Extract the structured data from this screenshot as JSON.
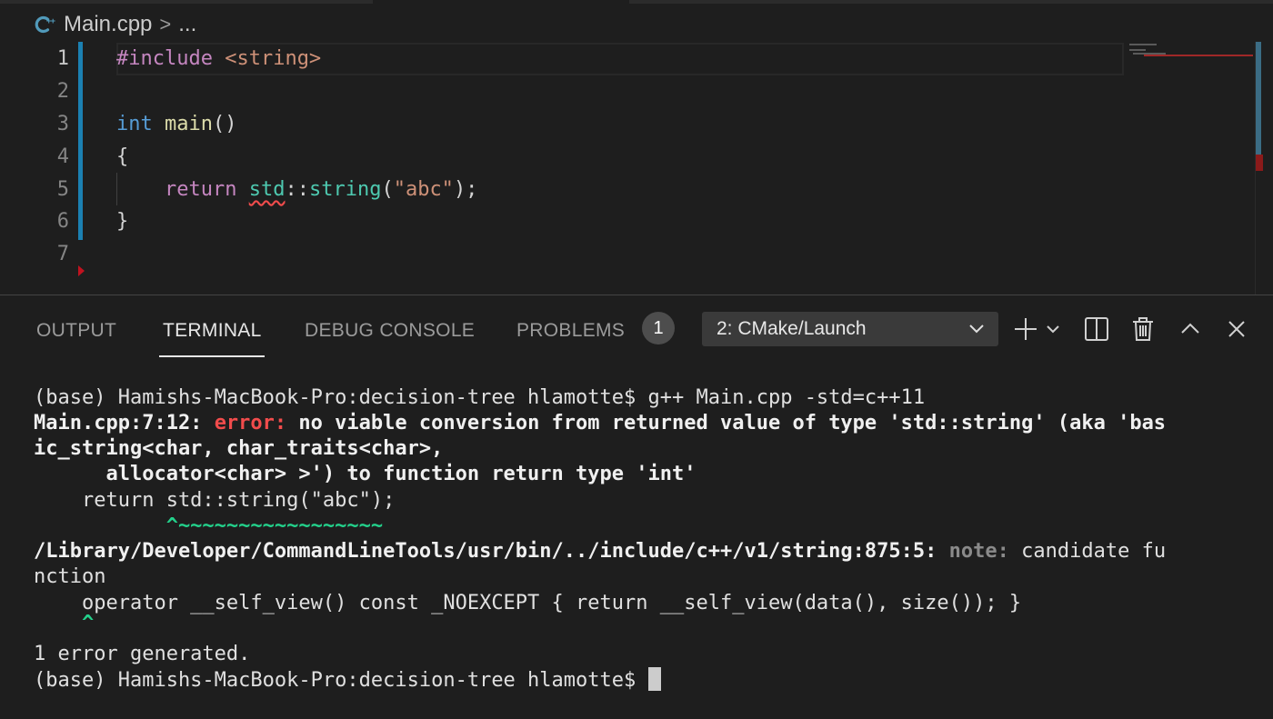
{
  "breadcrumb": {
    "file": "Main.cpp",
    "separator": ">",
    "more": "..."
  },
  "editor": {
    "line_numbers": [
      "1",
      "2",
      "3",
      "4",
      "5",
      "6",
      "7"
    ],
    "lines": {
      "l1_directive": "#include",
      "l1_header": "<string>",
      "l3_type": "int",
      "l3_name": "main",
      "l3_parens": "()",
      "l4_brace": "{",
      "l5_return": "return",
      "l5_ns": "std",
      "l5_scope": "::",
      "l5_class": "string",
      "l5_open": "(",
      "l5_str": "\"abc\"",
      "l5_close": ");",
      "l6_brace": "}"
    }
  },
  "panel": {
    "tabs": {
      "output": "OUTPUT",
      "terminal": "TERMINAL",
      "debug": "DEBUG CONSOLE",
      "problems": "PROBLEMS"
    },
    "problems_count": "1",
    "terminal_select": "2: CMake/Launch",
    "icons": [
      "plus-icon",
      "chevron-down-icon",
      "split-icon",
      "trash-icon",
      "chevron-up-icon",
      "close-icon"
    ]
  },
  "terminal": {
    "l1": "(base) Hamishs-MacBook-Pro:decision-tree hlamotte$ g++ Main.cpp -std=c++11",
    "l2_loc": "Main.cpp:7:12: ",
    "l2_err": "error: ",
    "l2_msg": "no viable conversion from returned value of type 'std::string' (aka 'bas",
    "l3": "ic_string<char, char_traits<char>,",
    "l4": "      allocator<char> >') to function return type 'int'",
    "l5": "    return std::string(\"abc\");",
    "l6": "           ^~~~~~~~~~~~~~~~~~",
    "l7_loc": "/Library/Developer/CommandLineTools/usr/bin/../include/c++/v1/string:875:5: ",
    "l7_note": "note: ",
    "l7_msg": "candidate fu",
    "l8": "nction",
    "l9": "    operator __self_view() const _NOEXCEPT { return __self_view(data(), size()); }",
    "l10": "    ^",
    "l11": "1 error generated.",
    "l12": "(base) Hamishs-MacBook-Pro:decision-tree hlamotte$ "
  },
  "colors": {
    "background": "#1e1e1e",
    "error": "#f14c4c",
    "git_modified": "#1b80b2",
    "caret_green": "#23d18b"
  }
}
